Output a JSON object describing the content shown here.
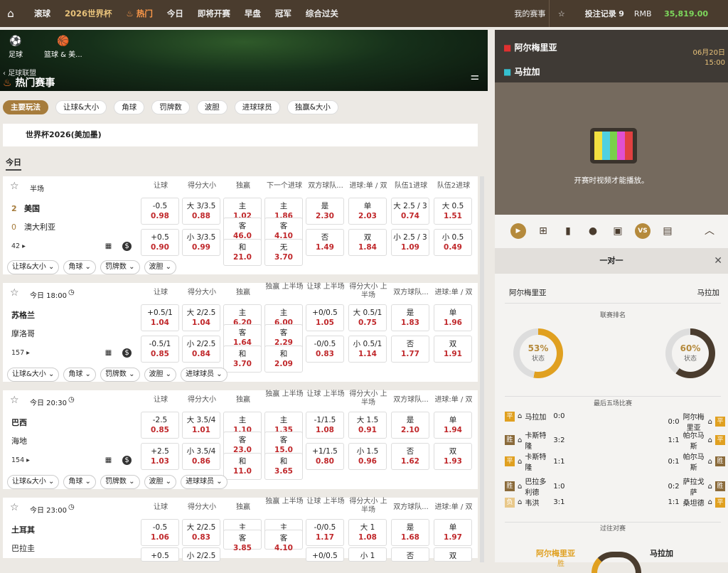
{
  "topnav": {
    "items": [
      "滚球",
      "2026世界杯",
      "热门",
      "今日",
      "即将开赛",
      "早盘",
      "冠军",
      "综合过关"
    ],
    "my_matches": "我的赛事",
    "bets_label": "投注记录",
    "bets_count": "9",
    "currency": "RMB",
    "balance": "35,819.00"
  },
  "hero": {
    "sport1": "足球",
    "sport2": "篮球 & 美...",
    "back": "足球联盟",
    "title": "热门赛事"
  },
  "pills": [
    "主要玩法",
    "让球&大小",
    "角球",
    "罚牌数",
    "波胆",
    "进球球员",
    "独赢&大小"
  ],
  "league": "世界杯2026(美加墨)",
  "today": "今日",
  "cards": [
    {
      "info": "半场",
      "headers": [
        "让球",
        "得分大小",
        "独赢",
        "下一个进球",
        "双方球队...",
        "进球:单 / 双",
        "队伍1进球",
        "队伍2进球"
      ],
      "home": "美国",
      "away": "澳大利亚",
      "home_score": "2",
      "away_score": "0",
      "count": "42",
      "row1": [
        [
          "-0.5",
          "0.98"
        ],
        [
          "大 3/3.5",
          "0.88"
        ],
        [
          "主",
          "1.02"
        ],
        [
          "主",
          "1.86"
        ],
        [
          "是",
          "2.30"
        ],
        [
          "单",
          "2.03"
        ],
        [
          "大 2.5 / 3",
          "0.74"
        ],
        [
          "大 0.5",
          "1.51"
        ]
      ],
      "row2": [
        [
          "+0.5",
          "0.90"
        ],
        [
          "小 3/3.5",
          "0.99"
        ],
        [
          "客",
          "46.0"
        ],
        [
          "客",
          "4.10"
        ],
        [
          "否",
          "1.49"
        ],
        [
          "双",
          "1.84"
        ],
        [
          "小 2.5 / 3",
          "1.09"
        ],
        [
          "小 0.5",
          "0.49"
        ]
      ],
      "row3": [
        [
          "和",
          "21.0"
        ],
        [
          "无",
          "3.70"
        ]
      ],
      "tags": [
        "让球&大小",
        "角球",
        "罚牌数",
        "波胆"
      ]
    },
    {
      "info": "今日 18:00",
      "headers": [
        "让球",
        "得分大小",
        "独赢",
        "独赢 上半场",
        "让球 上半场",
        "得分大小 上半场",
        "双方球队...",
        "进球:单 / 双"
      ],
      "home": "苏格兰",
      "away": "摩洛哥",
      "count": "157",
      "row1": [
        [
          "+0.5/1",
          "1.04"
        ],
        [
          "大 2/2.5",
          "1.04"
        ],
        [
          "主",
          "6.20"
        ],
        [
          "主",
          "6.00"
        ],
        [
          "+0/0.5",
          "1.05"
        ],
        [
          "大 0.5/1",
          "0.75"
        ],
        [
          "是",
          "1.83"
        ],
        [
          "单",
          "1.96"
        ]
      ],
      "row2": [
        [
          "-0.5/1",
          "0.85"
        ],
        [
          "小 2/2.5",
          "0.84"
        ],
        [
          "客",
          "1.64"
        ],
        [
          "客",
          "2.29"
        ],
        [
          "-0/0.5",
          "0.83"
        ],
        [
          "小 0.5/1",
          "1.14"
        ],
        [
          "否",
          "1.77"
        ],
        [
          "双",
          "1.91"
        ]
      ],
      "row3": [
        [
          "和",
          "3.70"
        ],
        [
          "和",
          "2.09"
        ]
      ],
      "tags": [
        "让球&大小",
        "角球",
        "罚牌数",
        "波胆",
        "进球球员"
      ]
    },
    {
      "info": "今日 20:30",
      "headers": [
        "让球",
        "得分大小",
        "独赢",
        "独赢 上半场",
        "让球 上半场",
        "得分大小 上半场",
        "双方球队...",
        "进球:单 / 双"
      ],
      "home": "巴西",
      "away": "海地",
      "count": "154",
      "row1": [
        [
          "-2.5",
          "0.85"
        ],
        [
          "大 3.5/4",
          "1.01"
        ],
        [
          "主",
          "1.10"
        ],
        [
          "主",
          "1.35"
        ],
        [
          "-1/1.5",
          "1.08"
        ],
        [
          "大 1.5",
          "0.91"
        ],
        [
          "是",
          "2.10"
        ],
        [
          "单",
          "1.94"
        ]
      ],
      "row2": [
        [
          "+2.5",
          "1.03"
        ],
        [
          "小 3.5/4",
          "0.86"
        ],
        [
          "客",
          "23.0"
        ],
        [
          "客",
          "15.0"
        ],
        [
          "+1/1.5",
          "0.80"
        ],
        [
          "小 1.5",
          "0.96"
        ],
        [
          "否",
          "1.62"
        ],
        [
          "双",
          "1.93"
        ]
      ],
      "row3": [
        [
          "和",
          "11.0"
        ],
        [
          "和",
          "3.65"
        ]
      ],
      "tags": [
        "让球&大小",
        "角球",
        "罚牌数",
        "波胆",
        "进球球员"
      ]
    },
    {
      "info": "今日 23:00",
      "headers": [
        "让球",
        "得分大小",
        "独赢",
        "独赢 上半场",
        "让球 上半场",
        "得分大小 上半场",
        "双方球队...",
        "进球:单 / 双"
      ],
      "home": "土耳其",
      "away": "巴拉圭",
      "row1": [
        [
          "-0.5",
          "1.06"
        ],
        [
          "大 2/2.5",
          "0.83"
        ],
        [
          "主",
          "2.06"
        ],
        [
          "主",
          "2.66"
        ],
        [
          "-0/0.5",
          "1.17"
        ],
        [
          "大 1",
          "1.08"
        ],
        [
          "是",
          "1.68"
        ],
        [
          "单",
          "1.97"
        ]
      ],
      "row2_partial": [
        [
          "+0.5",
          ""
        ],
        [
          "小 2/2.5",
          ""
        ],
        [
          "客",
          "3.85"
        ],
        [
          "客",
          "4.10"
        ],
        [
          "+0/0.5",
          ""
        ],
        [
          "小 1",
          ""
        ],
        [
          "否",
          ""
        ],
        [
          "双",
          ""
        ]
      ]
    }
  ],
  "right": {
    "home": "阿尔梅里亚",
    "away": "马拉加",
    "date": "06月20日",
    "time": "15:00",
    "video_msg": "开赛时视频才能播放。",
    "panel_title": "一对一",
    "league_rank": "联赛排名",
    "home_pct": "53%",
    "away_pct": "60%",
    "state": "状态",
    "last5": "最后五场比赛",
    "left_games": [
      [
        "平",
        "马拉加",
        "0:0"
      ],
      [
        "胜",
        "卡斯特隆",
        "3:2"
      ],
      [
        "平",
        "卡斯特隆",
        "1:1"
      ],
      [
        "胜",
        "巴拉多利德",
        "1:0"
      ],
      [
        "负",
        "韦洪",
        "3:1"
      ]
    ],
    "right_games": [
      [
        "0:0",
        "阿尔梅里亚",
        "平"
      ],
      [
        "1:1",
        "帕尔马斯",
        "平"
      ],
      [
        "0:1",
        "帕尔马斯",
        "胜"
      ],
      [
        "0:2",
        "萨拉戈萨",
        "胜"
      ],
      [
        "1:1",
        "桑坦德",
        "平"
      ]
    ],
    "h2h": "过往对赛",
    "h2h_home": "阿尔梅里亚",
    "h2h_away": "马拉加",
    "h2h_home_sub": "胜"
  },
  "colors": {
    "nav": "#4a3c2e",
    "accent": "#a67c3c",
    "odds": "#c0282b",
    "balance": "#7dd85c"
  }
}
